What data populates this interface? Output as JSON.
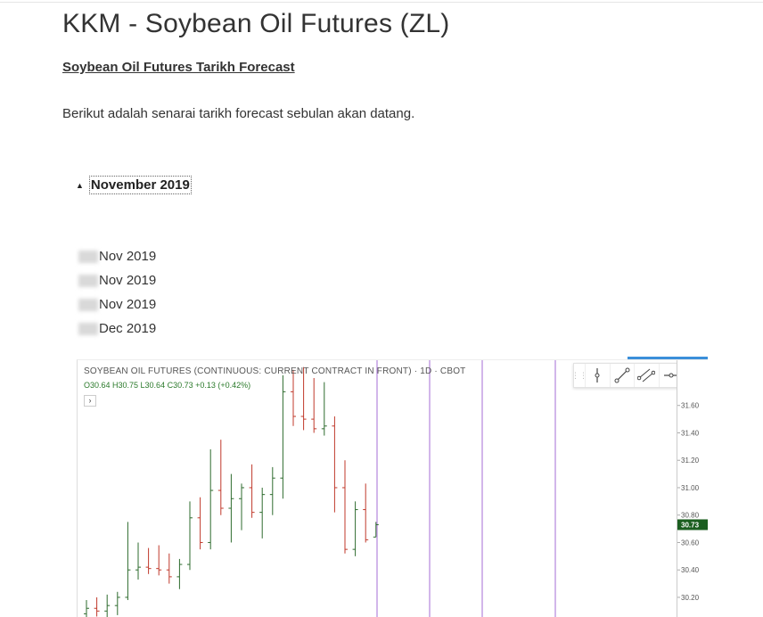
{
  "page": {
    "title": "KKM - Soybean Oil Futures (ZL)",
    "subtitle": "Soybean Oil Futures Tarikh Forecast",
    "intro": "Berikut adalah senarai tarikh forecast sebulan akan datang."
  },
  "accordion": {
    "label": "November 2019",
    "expanded": true,
    "dates": [
      "Nov 2019",
      "Nov 2019",
      "Nov 2019",
      "Dec 2019"
    ]
  },
  "chart_data": {
    "type": "ohlc",
    "title": "SOYBEAN OIL FUTURES (CONTINUOUS: CURRENT CONTRACT IN FRONT) · 1D · CBOT",
    "ohlc_text": "O30.64  H30.75  L30.64  C30.73  +0.13 (+0.42%)",
    "last_price": "30.73",
    "y_ticks": [
      "31.60",
      "31.40",
      "31.20",
      "31.00",
      "30.80",
      "30.60",
      "30.40",
      "30.20"
    ],
    "ylim": [
      30.05,
      31.93
    ],
    "bars": [
      {
        "o": 30.08,
        "h": 30.18,
        "l": 30.05,
        "c": 30.12
      },
      {
        "o": 30.12,
        "h": 30.2,
        "l": 30.06,
        "c": 30.1
      },
      {
        "o": 30.1,
        "h": 30.22,
        "l": 30.05,
        "c": 30.14
      },
      {
        "o": 30.14,
        "h": 30.24,
        "l": 30.07,
        "c": 30.2
      },
      {
        "o": 30.2,
        "h": 30.75,
        "l": 30.18,
        "c": 30.4
      },
      {
        "o": 30.4,
        "h": 30.6,
        "l": 30.33,
        "c": 30.42
      },
      {
        "o": 30.42,
        "h": 30.56,
        "l": 30.37,
        "c": 30.41
      },
      {
        "o": 30.41,
        "h": 30.58,
        "l": 30.36,
        "c": 30.4
      },
      {
        "o": 30.4,
        "h": 30.52,
        "l": 30.3,
        "c": 30.35
      },
      {
        "o": 30.35,
        "h": 30.48,
        "l": 30.26,
        "c": 30.44
      },
      {
        "o": 30.44,
        "h": 30.9,
        "l": 30.4,
        "c": 30.78
      },
      {
        "o": 30.78,
        "h": 30.93,
        "l": 30.55,
        "c": 30.6
      },
      {
        "o": 30.6,
        "h": 31.28,
        "l": 30.55,
        "c": 30.98
      },
      {
        "o": 30.98,
        "h": 31.35,
        "l": 30.8,
        "c": 30.85
      },
      {
        "o": 30.85,
        "h": 31.1,
        "l": 30.6,
        "c": 30.92
      },
      {
        "o": 30.92,
        "h": 31.03,
        "l": 30.69,
        "c": 31.0
      },
      {
        "o": 31.0,
        "h": 31.17,
        "l": 30.78,
        "c": 30.82
      },
      {
        "o": 30.82,
        "h": 31.0,
        "l": 30.63,
        "c": 30.95
      },
      {
        "o": 30.95,
        "h": 31.15,
        "l": 30.8,
        "c": 31.07
      },
      {
        "o": 31.07,
        "h": 31.82,
        "l": 30.92,
        "c": 31.7
      },
      {
        "o": 31.7,
        "h": 31.86,
        "l": 31.45,
        "c": 31.52
      },
      {
        "o": 31.52,
        "h": 31.88,
        "l": 31.42,
        "c": 31.5
      },
      {
        "o": 31.5,
        "h": 31.8,
        "l": 31.4,
        "c": 31.43
      },
      {
        "o": 31.43,
        "h": 31.77,
        "l": 31.38,
        "c": 31.45
      },
      {
        "o": 31.45,
        "h": 31.52,
        "l": 30.82,
        "c": 31.0
      },
      {
        "o": 31.0,
        "h": 31.2,
        "l": 30.52,
        "c": 30.55
      },
      {
        "o": 30.55,
        "h": 30.9,
        "l": 30.5,
        "c": 30.84
      },
      {
        "o": 30.84,
        "h": 31.03,
        "l": 30.6,
        "c": 30.62
      },
      {
        "o": 30.64,
        "h": 30.75,
        "l": 30.64,
        "c": 30.73
      }
    ]
  }
}
